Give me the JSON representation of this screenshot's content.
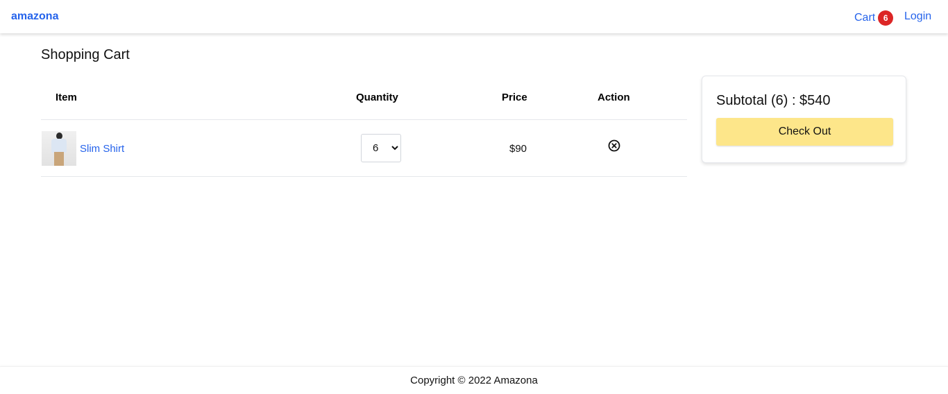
{
  "navbar": {
    "brand": "amazona",
    "cart_label": "Cart",
    "cart_count": "6",
    "login_label": "Login"
  },
  "page": {
    "title": "Shopping Cart"
  },
  "table": {
    "headers": {
      "item": "Item",
      "quantity": "Quantity",
      "price": "Price",
      "action": "Action"
    },
    "rows": [
      {
        "name": "Slim Shirt",
        "quantity": "6",
        "price": "$90"
      }
    ]
  },
  "summary": {
    "subtotal": "Subtotal (6) : $540",
    "checkout_label": "Check Out"
  },
  "footer": {
    "copyright": "Copyright © 2022 Amazona"
  },
  "icons": {
    "remove": "x-circle-icon"
  },
  "colors": {
    "link": "#2563eb",
    "badge": "#dc2626",
    "checkout_button": "#fde68a"
  }
}
